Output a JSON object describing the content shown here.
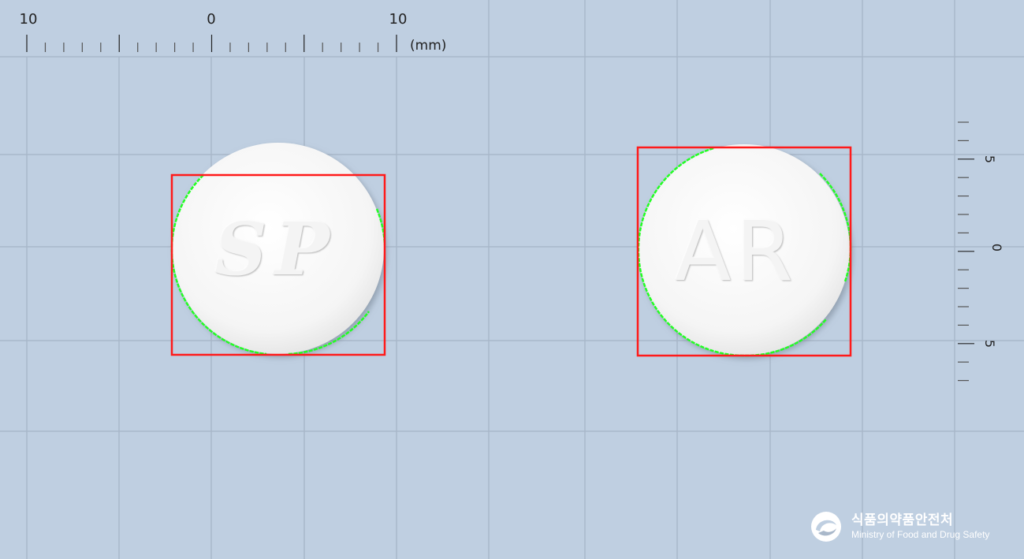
{
  "ruler": {
    "top_labels": [
      "10",
      "0",
      "10"
    ],
    "unit": "(mm)",
    "right_labels": [
      "5",
      "0",
      "5"
    ]
  },
  "pills": [
    {
      "imprint": "SP"
    },
    {
      "imprint": "AR"
    }
  ],
  "logo": {
    "korean": "식품의약품안전처",
    "english": "Ministry of Food and Drug Safety"
  },
  "colors": {
    "background": "#bfcfe1",
    "grid": "#a9b8ca",
    "bbox": "#ff1a1a",
    "contour": "#22ff22",
    "pill": "#f7f7f7"
  }
}
